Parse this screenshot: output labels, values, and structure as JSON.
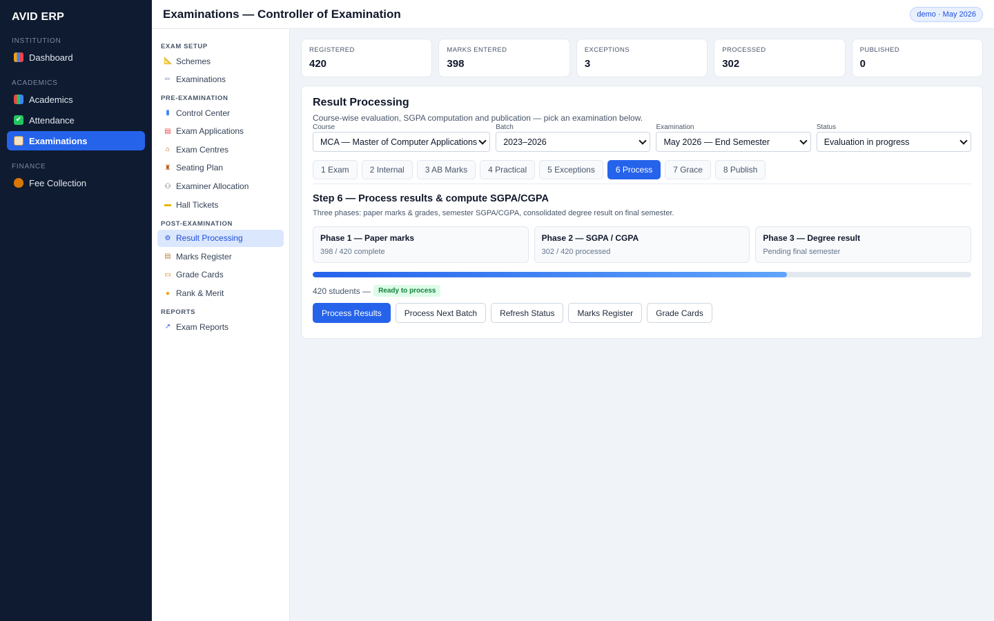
{
  "app": {
    "brand": "AVID ERP"
  },
  "sidebar": {
    "sections": [
      {
        "label": "INSTITUTION",
        "items": [
          {
            "label": "Dashboard",
            "icon": "bar-chart-icon"
          }
        ]
      },
      {
        "label": "ACADEMICS",
        "items": [
          {
            "label": "Academics",
            "icon": "books-icon"
          },
          {
            "label": "Attendance",
            "icon": "checkbox-icon"
          },
          {
            "label": "Examinations",
            "icon": "clipboard-icon",
            "active": true
          }
        ]
      },
      {
        "label": "FINANCE",
        "items": [
          {
            "label": "Fee Collection",
            "icon": "money-bag-icon"
          }
        ]
      }
    ]
  },
  "header": {
    "title": "Examinations — Controller of Examination",
    "badge": "demo · May 2026"
  },
  "subnav": {
    "exam_setup": {
      "label": "EXAM SETUP",
      "items": [
        "Schemes",
        "Examinations"
      ]
    },
    "pre_exam": {
      "label": "PRE-EXAMINATION",
      "items": [
        "Control Center",
        "Exam Applications",
        "Exam Centres",
        "Seating Plan",
        "Examiner Allocation",
        "Hall Tickets"
      ]
    },
    "post_exam": {
      "label": "POST-EXAMINATION",
      "items": [
        "Result Processing",
        "Marks Register",
        "Grade Cards",
        "Rank & Merit"
      ]
    },
    "reports": {
      "label": "REPORTS",
      "items": [
        "Exam Reports"
      ]
    }
  },
  "stats": [
    {
      "label": "REGISTERED",
      "value": "420"
    },
    {
      "label": "MARKS ENTERED",
      "value": "398"
    },
    {
      "label": "EXCEPTIONS",
      "value": "3"
    },
    {
      "label": "PROCESSED",
      "value": "302"
    },
    {
      "label": "PUBLISHED",
      "value": "0"
    }
  ],
  "card": {
    "title": "Result Processing",
    "description": "Course-wise evaluation, SGPA computation and publication — pick an examination below."
  },
  "filters": {
    "course": {
      "label": "Course",
      "value": "MCA — Master of Computer Applications"
    },
    "batch": {
      "label": "Batch",
      "value": "2023–2026"
    },
    "examination": {
      "label": "Examination",
      "value": "May 2026 — End Semester"
    },
    "status": {
      "label": "Status",
      "value": "Evaluation in progress"
    }
  },
  "steps": [
    "1 Exam",
    "2 Internal",
    "3 AB Marks",
    "4 Practical",
    "5 Exceptions",
    "6 Process",
    "7 Grace",
    "8 Publish"
  ],
  "active_step": 5,
  "step": {
    "title": "Step 6 — Process results & compute SGPA/CGPA",
    "description": "Three phases: paper marks & grades, semester SGPA/CGPA, consolidated degree result on final semester."
  },
  "phases": [
    {
      "title": "Phase 1 — Paper marks",
      "sub": "398 / 420 complete"
    },
    {
      "title": "Phase 2 — SGPA / CGPA",
      "sub": "302 / 420 processed"
    },
    {
      "title": "Phase 3 — Degree result",
      "sub": "Pending final semester"
    }
  ],
  "progress": {
    "percent": 72
  },
  "status_row": {
    "text": "420 students —",
    "badge": "Ready to process"
  },
  "actions": {
    "process": "Process Results",
    "next_batch": "Process Next Batch",
    "refresh": "Refresh Status",
    "marks_register": "Marks Register",
    "grade_cards": "Grade Cards"
  },
  "colors": {
    "accent": "#2563eb",
    "sidebar_bg": "#0f1b31",
    "success": "#15803d"
  }
}
